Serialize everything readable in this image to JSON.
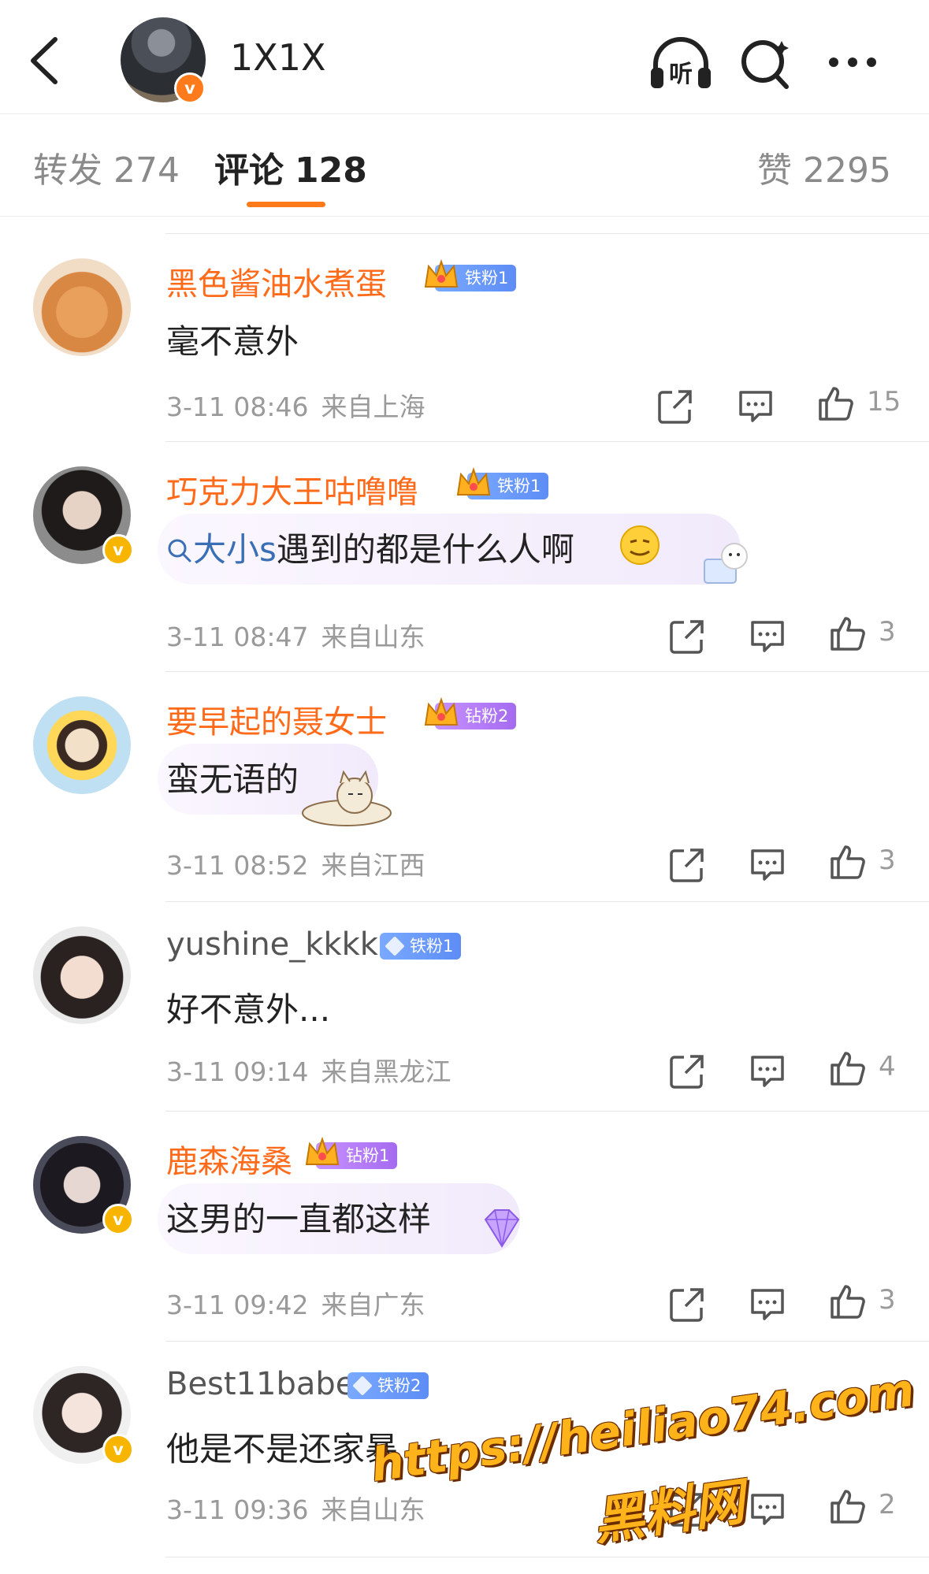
{
  "header": {
    "title": "1X1X",
    "listen_label": "听"
  },
  "tabs": {
    "repost": {
      "label": "转发",
      "count": "274"
    },
    "comments": {
      "label": "评论",
      "count": "128"
    },
    "likes": {
      "label": "赞",
      "count": "2295"
    }
  },
  "comments": [
    {
      "username": "黑色酱油水煮蛋",
      "badge": "铁粉1",
      "text": "毫不意外",
      "date": "3-11 08:46",
      "location": "来自上海",
      "likes": "15"
    },
    {
      "username": "巧克力大王咕噜噜",
      "badge": "铁粉1",
      "search_text": "大小s",
      "text": "遇到的都是什么人啊",
      "date": "3-11 08:47",
      "location": "来自山东",
      "likes": "3"
    },
    {
      "username": "要早起的聂女士",
      "badge": "钻粉2",
      "text": "蛮无语的",
      "date": "3-11 08:52",
      "location": "来自江西",
      "likes": "3"
    },
    {
      "username": "yushine_kkkk",
      "badge": "铁粉1",
      "text": "好不意外...",
      "date": "3-11 09:14",
      "location": "来自黑龙江",
      "likes": "4"
    },
    {
      "username": "鹿森海桑",
      "badge": "钻粉1",
      "text": "这男的一直都这样",
      "date": "3-11 09:42",
      "location": "来自广东",
      "likes": "3"
    },
    {
      "username": "Best11babe",
      "badge": "铁粉2",
      "text": "他是不是还家暴",
      "date": "3-11 09:36",
      "location": "来自山东",
      "likes": "2"
    }
  ],
  "watermark": {
    "url": "https://heiliao74.com",
    "name": "黑料网"
  },
  "colors": {
    "accent": "#ff7a1a",
    "username": "#ff6b1a",
    "meta": "#9a9a9a",
    "iron_badge": "#5d8df5",
    "diamond_badge": "#a56bf0"
  }
}
